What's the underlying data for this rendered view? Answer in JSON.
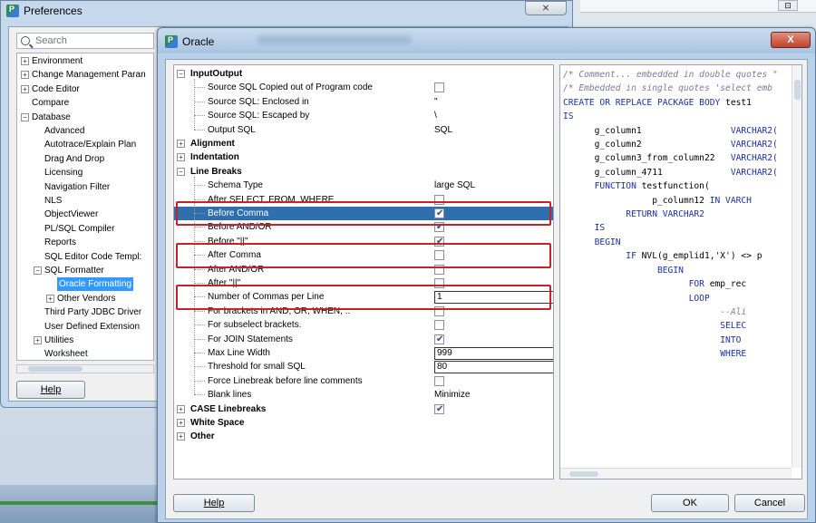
{
  "background": {
    "close_glyph": "⊡"
  },
  "preferences": {
    "title": "Preferences",
    "close_glyph": "⨯",
    "search_placeholder": "Search",
    "tree": [
      {
        "label": "Environment",
        "level": 0,
        "exp": "+"
      },
      {
        "label": "Change Management Paran",
        "level": 0,
        "exp": "+"
      },
      {
        "label": "Code Editor",
        "level": 0,
        "exp": "+"
      },
      {
        "label": "Compare",
        "level": 0,
        "exp": ""
      },
      {
        "label": "Database",
        "level": 0,
        "exp": "−"
      },
      {
        "label": "Advanced",
        "level": 1,
        "exp": ""
      },
      {
        "label": "Autotrace/Explain Plan",
        "level": 1,
        "exp": ""
      },
      {
        "label": "Drag And Drop",
        "level": 1,
        "exp": ""
      },
      {
        "label": "Licensing",
        "level": 1,
        "exp": ""
      },
      {
        "label": "Navigation Filter",
        "level": 1,
        "exp": ""
      },
      {
        "label": "NLS",
        "level": 1,
        "exp": ""
      },
      {
        "label": "ObjectViewer",
        "level": 1,
        "exp": ""
      },
      {
        "label": "PL/SQL Compiler",
        "level": 1,
        "exp": ""
      },
      {
        "label": "Reports",
        "level": 1,
        "exp": ""
      },
      {
        "label": "SQL Editor Code Templ:",
        "level": 1,
        "exp": ""
      },
      {
        "label": "SQL Formatter",
        "level": 1,
        "exp": "−"
      },
      {
        "label": "Oracle Formatting",
        "level": 2,
        "exp": "",
        "selected": true
      },
      {
        "label": "Other Vendors",
        "level": 2,
        "exp": "+"
      },
      {
        "label": "Third Party JDBC Driver",
        "level": 1,
        "exp": ""
      },
      {
        "label": "User Defined Extension",
        "level": 1,
        "exp": ""
      },
      {
        "label": "Utilities",
        "level": 1,
        "exp": "+"
      },
      {
        "label": "Worksheet",
        "level": 1,
        "exp": ""
      }
    ],
    "help_label": "Help"
  },
  "oracle": {
    "title": "Oracle",
    "close_glyph": "X",
    "settings": [
      {
        "type": "cat",
        "label": "InputOutput",
        "exp": "−"
      },
      {
        "type": "leaf",
        "label": "Source SQL Copied out of Program code",
        "control": "checkbox",
        "checked": false
      },
      {
        "type": "leaf",
        "label": "Source SQL: Enclosed in",
        "control": "text",
        "value": "\""
      },
      {
        "type": "leaf",
        "label": "Source SQL: Escaped by",
        "control": "text",
        "value": "\\"
      },
      {
        "type": "leaf",
        "label": "Output SQL",
        "control": "text",
        "value": "SQL"
      },
      {
        "type": "cat",
        "label": "Alignment",
        "exp": "+"
      },
      {
        "type": "cat",
        "label": "Indentation",
        "exp": "+"
      },
      {
        "type": "cat",
        "label": "Line Breaks",
        "exp": "−"
      },
      {
        "type": "leaf",
        "label": "Schema Type",
        "control": "text",
        "value": "large SQL"
      },
      {
        "type": "leaf",
        "label": "After SELECT, FROM, WHERE, ...",
        "control": "checkbox",
        "checked": false
      },
      {
        "type": "leaf",
        "label": "Before Comma",
        "control": "checkbox",
        "checked": true,
        "selected": true
      },
      {
        "type": "leaf",
        "label": "Before AND/OR",
        "control": "checkbox",
        "checked": true
      },
      {
        "type": "leaf",
        "label": "Before \"||\"",
        "control": "checkbox",
        "checked": true
      },
      {
        "type": "leaf",
        "label": "After Comma",
        "control": "checkbox",
        "checked": false
      },
      {
        "type": "leaf",
        "label": "After AND/OR",
        "control": "checkbox",
        "checked": false
      },
      {
        "type": "leaf",
        "label": "After \"||\"",
        "control": "checkbox",
        "checked": false
      },
      {
        "type": "leaf",
        "label": "Number of Commas per Line",
        "control": "field",
        "value": "1"
      },
      {
        "type": "leaf",
        "label": "For brackets in AND, OR, WHEN, ..",
        "control": "checkbox",
        "checked": false
      },
      {
        "type": "leaf",
        "label": "For subselect brackets.",
        "control": "checkbox",
        "checked": false
      },
      {
        "type": "leaf",
        "label": "For JOIN Statements",
        "control": "checkbox",
        "checked": true
      },
      {
        "type": "leaf",
        "label": "Max Line Width",
        "control": "field",
        "value": "999"
      },
      {
        "type": "leaf",
        "label": "Threshold for small SQL",
        "control": "field",
        "value": "80"
      },
      {
        "type": "leaf",
        "label": "Force Linebreak before line comments",
        "control": "checkbox",
        "checked": false
      },
      {
        "type": "leaf",
        "label": "Blank lines",
        "control": "text",
        "value": "Minimize"
      },
      {
        "type": "cat",
        "label": "CASE Linebreaks",
        "exp": "+",
        "control": "checkbox",
        "checked": true
      },
      {
        "type": "cat",
        "label": "White Space",
        "exp": "+"
      },
      {
        "type": "cat",
        "label": "Other",
        "exp": "+"
      }
    ],
    "code": [
      [
        [
          "cm",
          "/* Comment... embedded in double quotes \""
        ]
      ],
      [
        [
          "cm",
          "/* Embedded in single quotes 'select emb"
        ]
      ],
      [
        [
          "kw",
          "CREATE OR REPLACE PACKAGE BODY "
        ],
        [
          "pl",
          "test1"
        ]
      ],
      [
        [
          "kw",
          "IS"
        ]
      ],
      [
        [
          "pl",
          "      g_column1                 "
        ],
        [
          "kw",
          "VARCHAR2("
        ]
      ],
      [
        [
          "pl",
          "      g_column2                 "
        ],
        [
          "kw",
          "VARCHAR2("
        ]
      ],
      [
        [
          "pl",
          "      g_column3_from_column22   "
        ],
        [
          "kw",
          "VARCHAR2("
        ]
      ],
      [
        [
          "pl",
          "      g_column_4711             "
        ],
        [
          "kw",
          "VARCHAR2("
        ]
      ],
      [
        [
          "kw",
          "      FUNCTION "
        ],
        [
          "pl",
          "testfunction("
        ]
      ],
      [
        [
          "pl",
          "                 p_column12 "
        ],
        [
          "kw",
          "IN VARCH"
        ]
      ],
      [
        [
          "kw",
          "            RETURN VARCHAR2"
        ]
      ],
      [
        [
          "kw",
          "      IS"
        ]
      ],
      [
        [
          "kw",
          "      BEGIN"
        ]
      ],
      [
        [
          "kw",
          "            IF "
        ],
        [
          "pl",
          "NVL(g_emplid1,'X') <> p"
        ]
      ],
      [
        [
          "kw",
          "                  BEGIN"
        ]
      ],
      [
        [
          "kw",
          "                        FOR "
        ],
        [
          "pl",
          "emp_rec "
        ]
      ],
      [
        [
          "kw",
          "                        LOOP"
        ]
      ],
      [
        [
          "cm",
          "                              --Ali"
        ]
      ],
      [
        [
          "kw",
          "                              SELEC"
        ]
      ],
      [
        [
          "kw",
          "                              INTO"
        ]
      ],
      [
        [
          "kw",
          "                              WHERE"
        ]
      ]
    ],
    "help_label": "Help",
    "ok_label": "OK",
    "cancel_label": "Cancel"
  }
}
